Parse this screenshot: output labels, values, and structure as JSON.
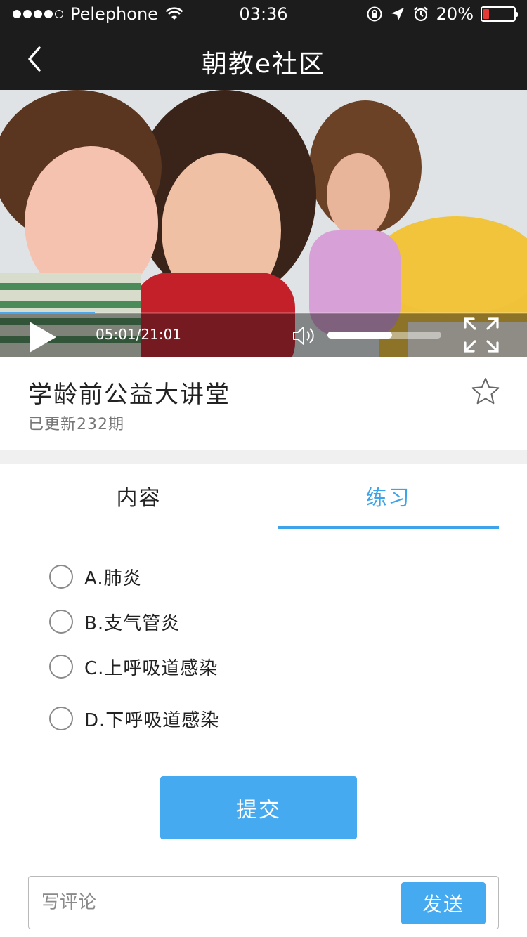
{
  "status_bar": {
    "carrier": "Pelephone",
    "time": "03:36",
    "battery_percent": "20%",
    "battery_level": 0.2,
    "icons": [
      "signal-dots",
      "wifi-icon",
      "lock-rotation-icon",
      "location-arrow-icon",
      "alarm-icon",
      "battery-icon"
    ]
  },
  "nav": {
    "title": "朝教e社区",
    "back_icon": "chevron-left-icon"
  },
  "video": {
    "time": "05:01/21:01",
    "progress_fraction": 0.18,
    "volume_fraction": 0.57,
    "colors": {
      "progress": "#4aa8ef"
    }
  },
  "course": {
    "title": "学龄前公益大讲堂",
    "subtitle": "已更新232期"
  },
  "tabs": [
    {
      "label": "内容",
      "active": false
    },
    {
      "label": "练习",
      "active": true
    }
  ],
  "options": [
    {
      "label": "A.肺炎"
    },
    {
      "label": "B.支气管炎"
    },
    {
      "label": "C.上呼吸道感染"
    },
    {
      "label": "D.下呼吸道感染"
    }
  ],
  "submit_label": "提交",
  "comment": {
    "placeholder": "写评论",
    "send_label": "发送"
  },
  "colors": {
    "accent": "#3ea4ea",
    "button": "#45aaf0",
    "bar_background": "#1c1c1c"
  }
}
